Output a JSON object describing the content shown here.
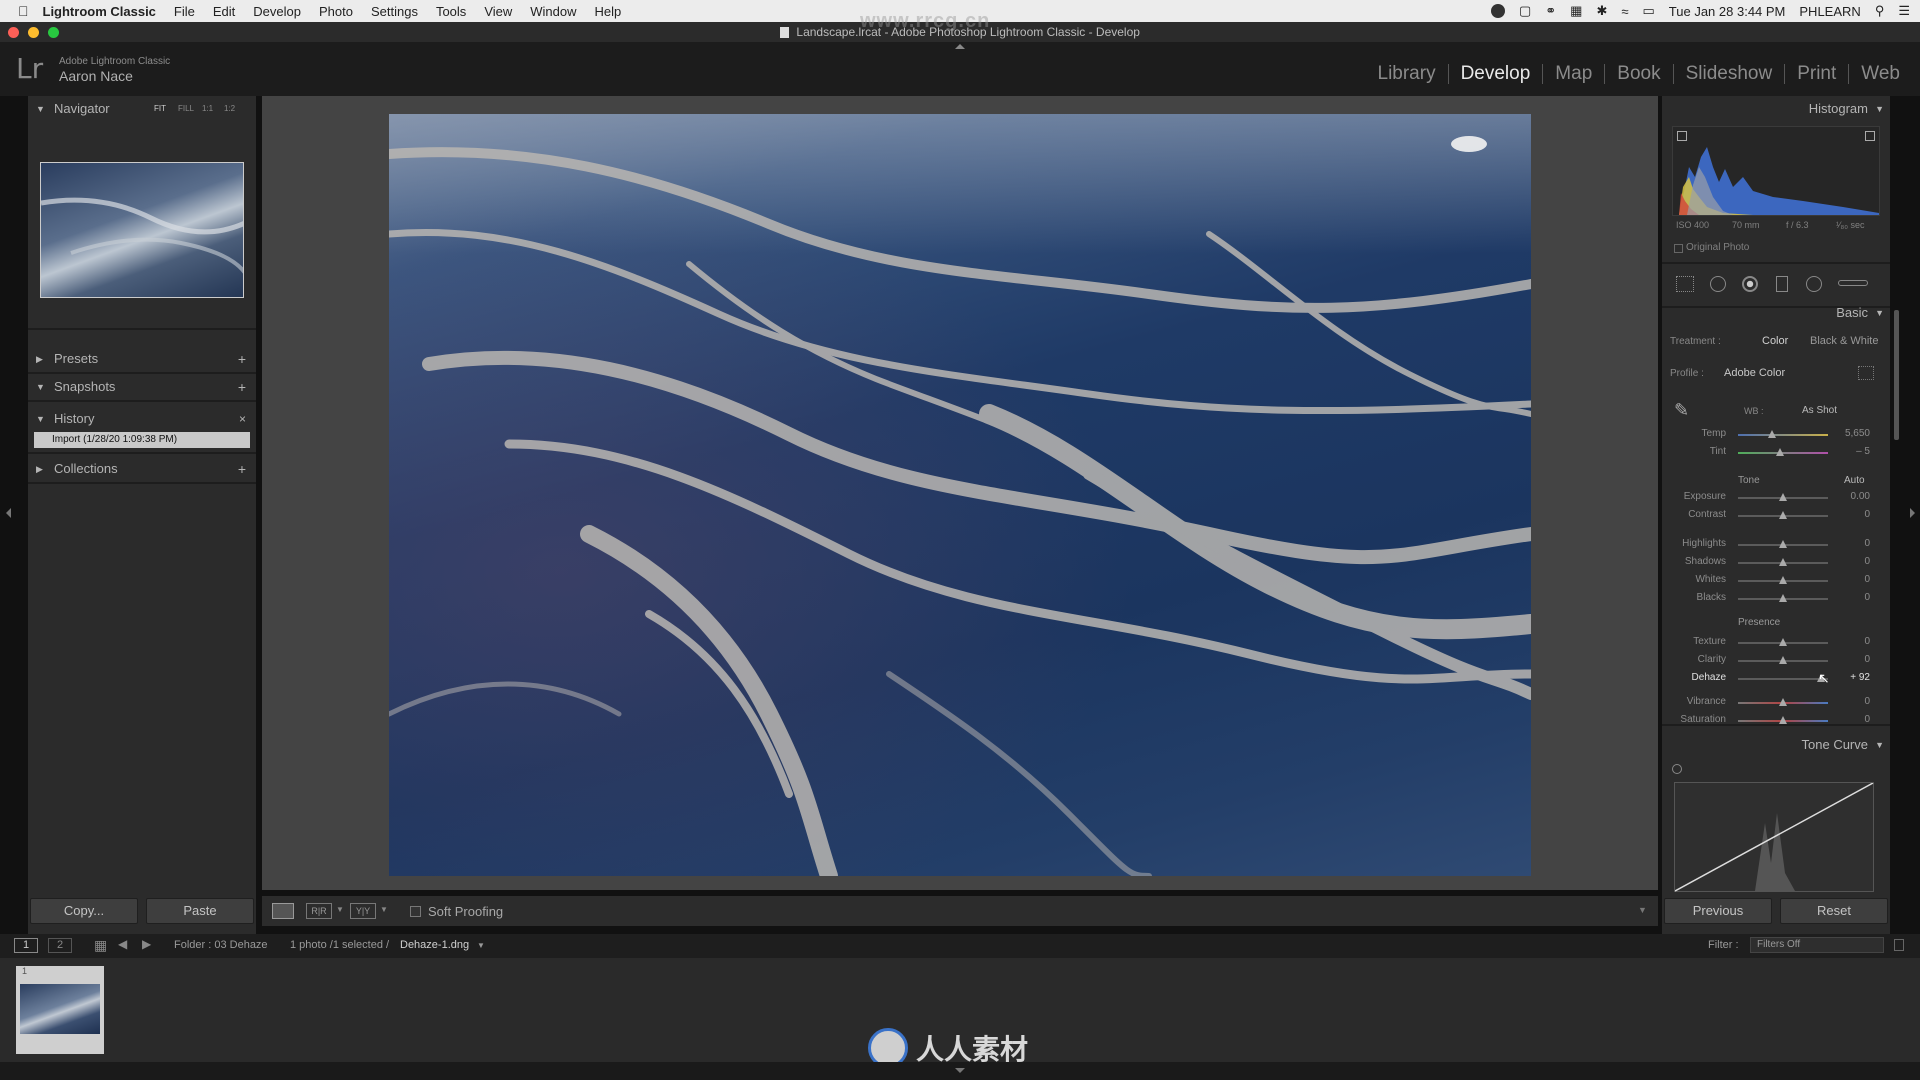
{
  "menubar": {
    "app_name": "Lightroom Classic",
    "items": [
      "File",
      "Edit",
      "Develop",
      "Photo",
      "Settings",
      "Tools",
      "View",
      "Window",
      "Help"
    ],
    "clock": "Tue Jan 28  3:44 PM",
    "user": "PHLEARN"
  },
  "window": {
    "title": "Landscape.lrcat - Adobe Photoshop Lightroom Classic - Develop"
  },
  "identity": {
    "product": "Adobe Lightroom Classic",
    "user": "Aaron Nace",
    "logo": "Lr"
  },
  "modules": [
    "Library",
    "Develop",
    "Map",
    "Book",
    "Slideshow",
    "Print",
    "Web"
  ],
  "active_module": "Develop",
  "left": {
    "navigator": {
      "title": "Navigator",
      "zoom_options": [
        "FIT",
        "FILL",
        "1:1",
        "1:2"
      ]
    },
    "presets": "Presets",
    "snapshots": "Snapshots",
    "history": {
      "title": "History",
      "entry": "Import (1/28/20 1:09:38 PM)"
    },
    "collections": "Collections",
    "copy_label": "Copy...",
    "paste_label": "Paste"
  },
  "right": {
    "histogram": {
      "title": "Histogram",
      "iso": "ISO 400",
      "focal": "70 mm",
      "aperture": "f / 6.3",
      "shutter": "¹⁄₈₀ sec",
      "original": "Original Photo"
    },
    "basic": {
      "title": "Basic",
      "treatment_label": "Treatment :",
      "color": "Color",
      "bw": "Black & White",
      "profile_label": "Profile :",
      "profile": "Adobe Color",
      "wb_label": "WB :",
      "wb": "As Shot",
      "tone_label": "Tone",
      "auto": "Auto",
      "presence_label": "Presence"
    },
    "sliders": [
      {
        "label": "Temp",
        "value": "5,650",
        "pos": 0.38
      },
      {
        "label": "Tint",
        "value": "– 5",
        "pos": 0.47
      },
      {
        "label": "Exposure",
        "value": "0.00",
        "pos": 0.5
      },
      {
        "label": "Contrast",
        "value": "0",
        "pos": 0.5
      },
      {
        "label": "Highlights",
        "value": "0",
        "pos": 0.5
      },
      {
        "label": "Shadows",
        "value": "0",
        "pos": 0.5
      },
      {
        "label": "Whites",
        "value": "0",
        "pos": 0.5
      },
      {
        "label": "Blacks",
        "value": "0",
        "pos": 0.5
      },
      {
        "label": "Texture",
        "value": "0",
        "pos": 0.5
      },
      {
        "label": "Clarity",
        "value": "0",
        "pos": 0.5
      },
      {
        "label": "Dehaze",
        "value": "+ 92",
        "pos": 0.92
      },
      {
        "label": "Vibrance",
        "value": "0",
        "pos": 0.5
      },
      {
        "label": "Saturation",
        "value": "0",
        "pos": 0.5
      }
    ],
    "tone_curve": "Tone Curve",
    "previous_label": "Previous",
    "reset_label": "Reset"
  },
  "toolbar": {
    "soft_proofing": "Soft Proofing"
  },
  "filmstrip": {
    "screen1": "1",
    "screen2": "2",
    "folder": "Folder : 03 Dehaze",
    "selection": "1 photo /1 selected /",
    "filename": "Dehaze-1.dng",
    "filter_label": "Filter :",
    "filter_value": "Filters Off",
    "thumb_index": "1"
  },
  "watermark": {
    "site": "www.rrcg.cn",
    "brand": "人人素材"
  }
}
